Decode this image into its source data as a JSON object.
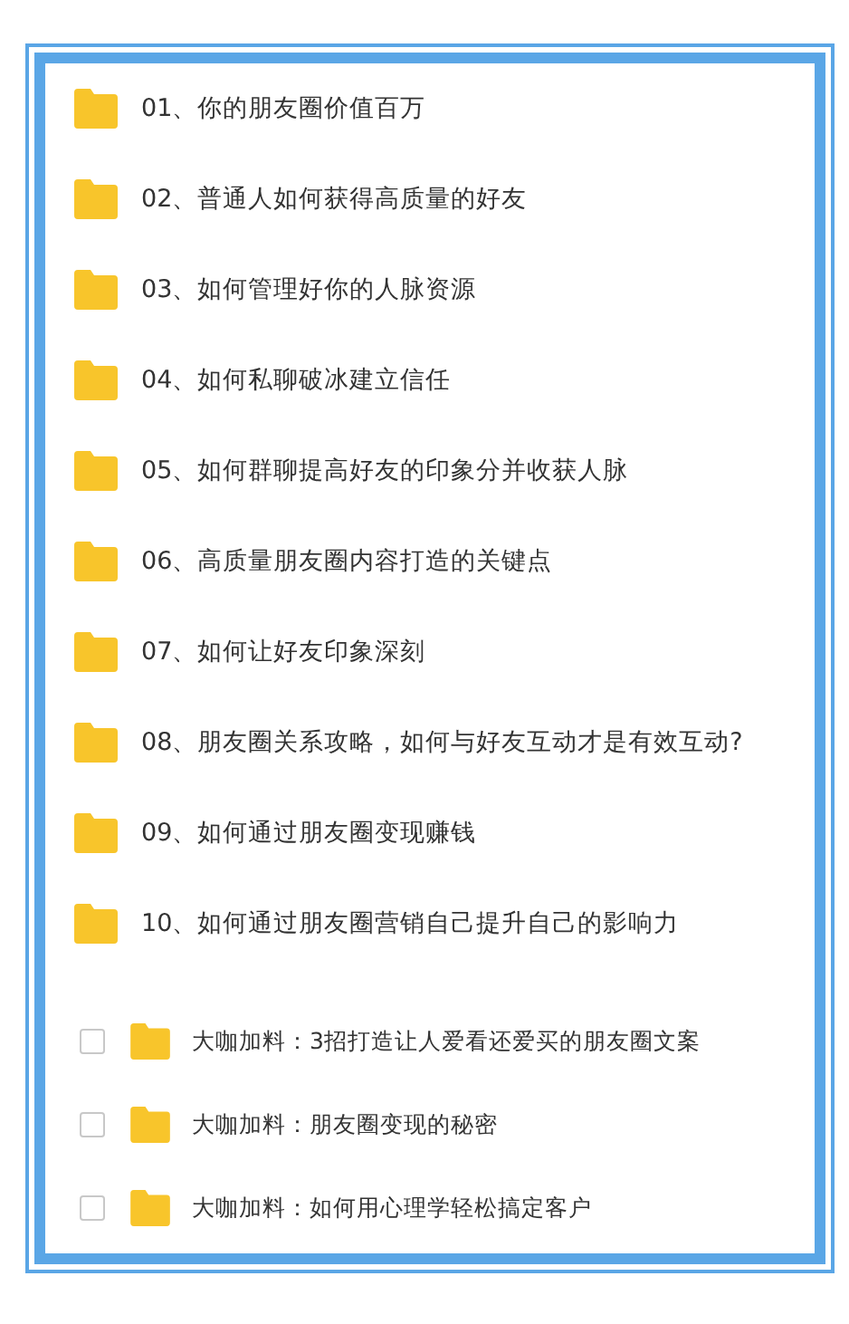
{
  "folders": [
    {
      "label": "01、你的朋友圈价值百万"
    },
    {
      "label": "02、普通人如何获得高质量的好友"
    },
    {
      "label": "03、如何管理好你的人脉资源"
    },
    {
      "label": "04、如何私聊破冰建立信任"
    },
    {
      "label": "05、如何群聊提高好友的印象分并收获人脉"
    },
    {
      "label": "06、高质量朋友圈内容打造的关键点"
    },
    {
      "label": "07、如何让好友印象深刻"
    },
    {
      "label": "08、朋友圈关系攻略，如何与好友互动才是有效互动?"
    },
    {
      "label": "09、如何通过朋友圈变现赚钱"
    },
    {
      "label": "10、如何通过朋友圈营销自己提升自己的影响力"
    }
  ],
  "extras": [
    {
      "label": "大咖加料：3招打造让人爱看还爱买的朋友圈文案",
      "checked": false
    },
    {
      "label": "大咖加料：朋友圈变现的秘密",
      "checked": false
    },
    {
      "label": "大咖加料：如何用心理学轻松搞定客户",
      "checked": false
    }
  ]
}
